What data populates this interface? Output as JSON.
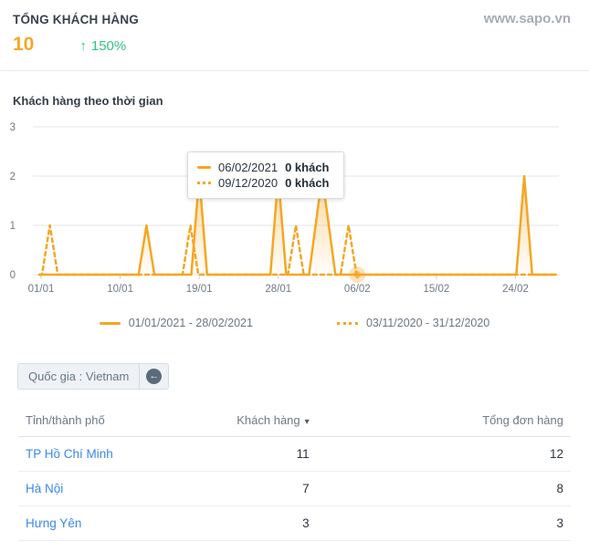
{
  "colors": {
    "accent": "#f5a623",
    "green": "#33c481",
    "link": "#3b87e8",
    "chip-bg": "#eef2f6",
    "chip-border": "#d5dde4",
    "chip-icon": "#5b6b7b"
  },
  "header": {
    "title": "TỔNG KHÁCH HÀNG",
    "total": "10",
    "delta_arrow": "↑",
    "delta": "150%",
    "watermark": "www.sapo.vn"
  },
  "chart": {
    "title": "Khách hàng theo thời gian",
    "tooltip": {
      "rows": [
        {
          "marker": "solid",
          "date": "06/02/2021",
          "value": "0 khách"
        },
        {
          "marker": "dotted",
          "date": "09/12/2020",
          "value": "0 khách"
        }
      ]
    },
    "legend": [
      {
        "style": "solid",
        "label": "01/01/2021 - 28/02/2021"
      },
      {
        "style": "dotted",
        "label": "03/11/2020 - 31/12/2020"
      }
    ]
  },
  "chart_data": {
    "type": "line",
    "title": "Khách hàng theo thời gian",
    "ylabel": "",
    "xlabel": "",
    "ylim": [
      0,
      3
    ],
    "yticks": [
      0,
      1,
      2,
      3
    ],
    "grid": true,
    "legend_position": "bottom",
    "x_days_total": 59,
    "xticks": [
      {
        "day": 0,
        "label": "01/01"
      },
      {
        "day": 9,
        "label": "10/01"
      },
      {
        "day": 18,
        "label": "19/01"
      },
      {
        "day": 27,
        "label": "28/01"
      },
      {
        "day": 36,
        "label": "06/02"
      },
      {
        "day": 45,
        "label": "15/02"
      },
      {
        "day": 54,
        "label": "24/02"
      }
    ],
    "series": [
      {
        "name": "01/01/2021 - 28/02/2021",
        "style": "solid",
        "color": "#f5a623",
        "fill": true,
        "spikes": [
          {
            "day": 12,
            "value": 1
          },
          {
            "day": 18,
            "value": 2
          },
          {
            "day": 27,
            "value": 2
          },
          {
            "day": 32,
            "value": 2,
            "width": 1.5
          },
          {
            "day": 55,
            "value": 2
          }
        ]
      },
      {
        "name": "03/11/2020 - 31/12/2020",
        "style": "dashed",
        "color": "#f5a623",
        "fill": false,
        "spikes": [
          {
            "day": 1,
            "value": 1
          },
          {
            "day": 17,
            "value": 1
          },
          {
            "day": 29,
            "value": 1
          },
          {
            "day": 35,
            "value": 1
          }
        ]
      }
    ],
    "highlight_point": {
      "day": 36,
      "value": 0,
      "label": "06/02"
    }
  },
  "filter_chip": {
    "label": "Quốc gia : Vietnam",
    "icon": "arrow-left-circle",
    "icon_glyph": "←"
  },
  "table": {
    "columns": [
      "Tỉnh/thành phố",
      "Khách hàng",
      "Tổng đơn hàng"
    ],
    "sorted_column": "Khách hàng",
    "sort_direction": "desc",
    "sort_icon": "▾",
    "rows": [
      {
        "province": "TP Hồ Chí Minh",
        "customers": "11",
        "orders": "12"
      },
      {
        "province": "Hà Nội",
        "customers": "7",
        "orders": "8"
      },
      {
        "province": "Hưng Yên",
        "customers": "3",
        "orders": "3"
      }
    ]
  }
}
